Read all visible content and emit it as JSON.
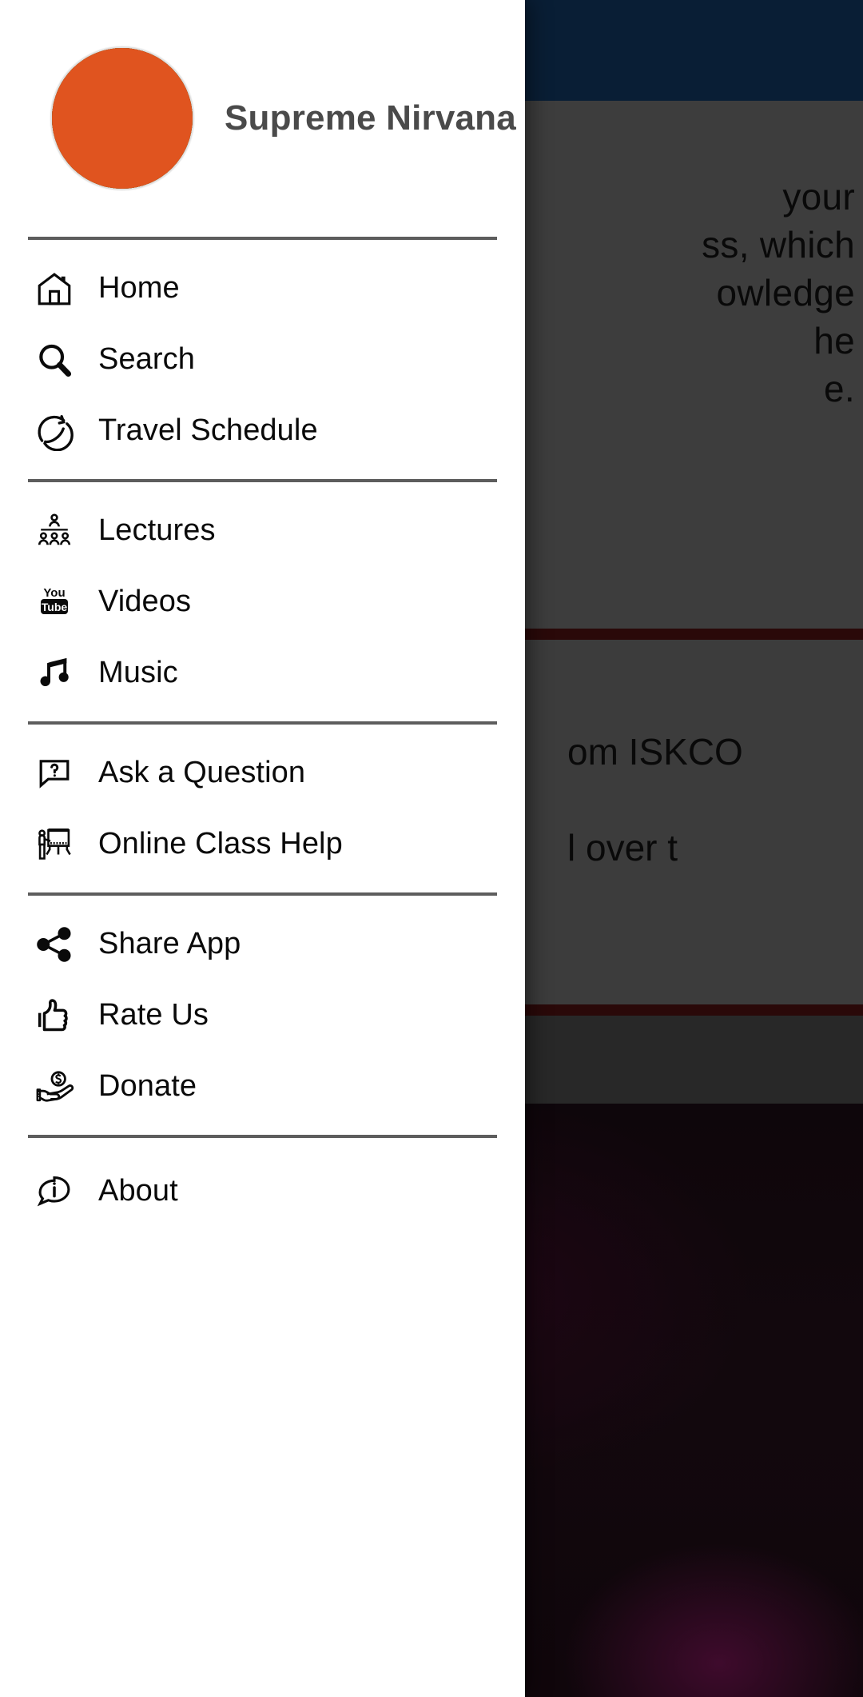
{
  "drawer": {
    "header": {
      "title": "Supreme Nirvana",
      "avatar_alt": "profile-photo"
    },
    "groups": [
      {
        "id": "primary",
        "items": [
          {
            "label": "Home",
            "icon": "home-icon"
          },
          {
            "label": "Search",
            "icon": "search-icon"
          },
          {
            "label": "Travel Schedule",
            "icon": "globe-plane-icon"
          }
        ]
      },
      {
        "id": "media",
        "items": [
          {
            "label": "Lectures",
            "icon": "audience-icon"
          },
          {
            "label": "Videos",
            "icon": "youtube-icon"
          },
          {
            "label": "Music",
            "icon": "music-note-icon"
          }
        ]
      },
      {
        "id": "support",
        "items": [
          {
            "label": "Ask a Question",
            "icon": "question-bubble-icon"
          },
          {
            "label": "Online Class Help",
            "icon": "teacher-board-icon"
          }
        ]
      },
      {
        "id": "engage",
        "items": [
          {
            "label": "Share App",
            "icon": "share-icon"
          },
          {
            "label": "Rate Us",
            "icon": "thumbs-up-icon"
          },
          {
            "label": "Donate",
            "icon": "hand-coin-icon"
          }
        ]
      },
      {
        "id": "info",
        "items": [
          {
            "label": "About",
            "icon": "info-bubble-icon"
          }
        ]
      }
    ]
  },
  "background": {
    "appbar_color": "#0e2c4d",
    "scrim_color": "rgba(0,0,0,0.30)",
    "accent_rule_color": "#3d0d0d",
    "text_fragments_top": [
      "your",
      "ss, which",
      "owledge",
      "he",
      "e."
    ],
    "text_fragments_mid": [
      "om  ISKCO",
      "l   over   t"
    ]
  }
}
